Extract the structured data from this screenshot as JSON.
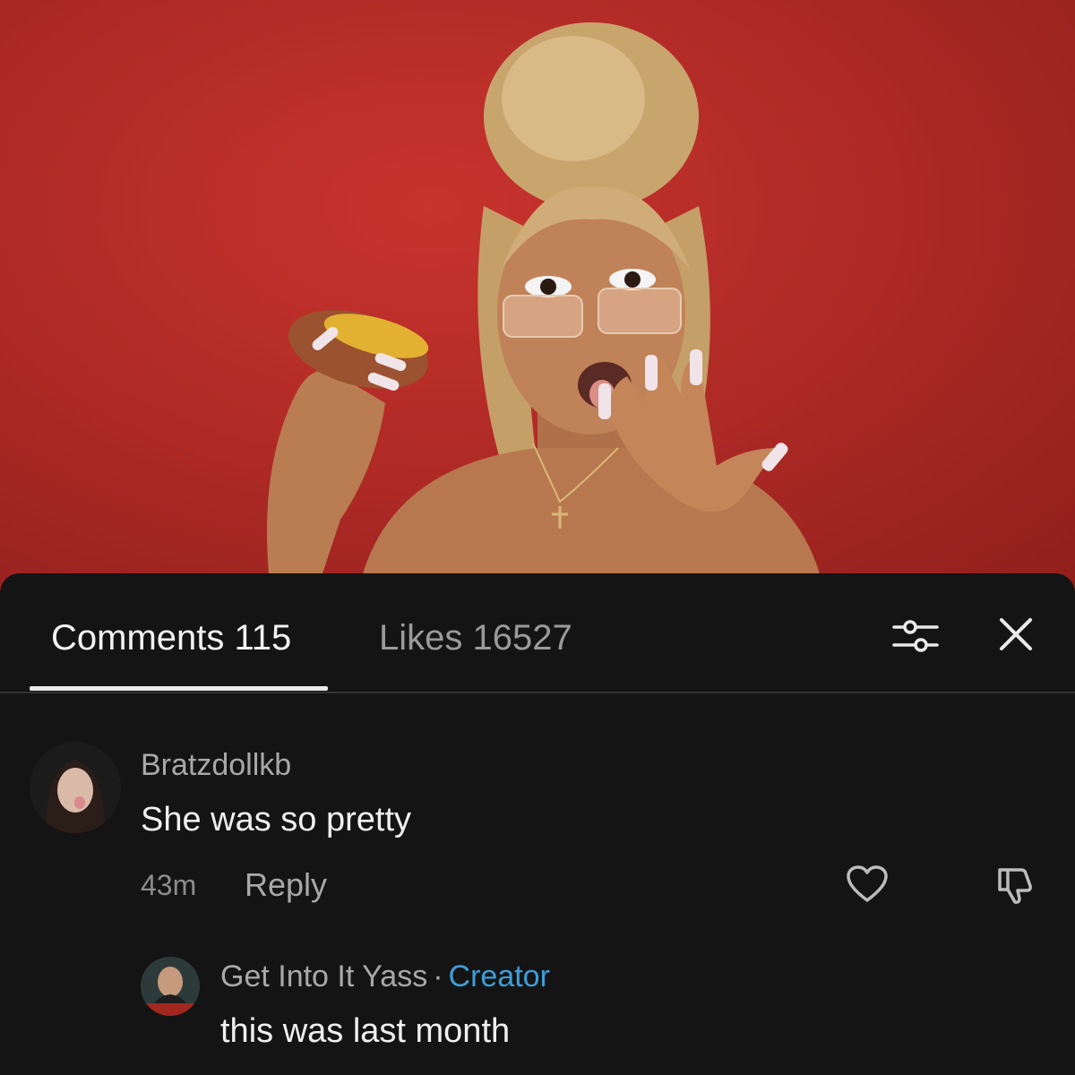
{
  "tabs": {
    "comments_label": "Comments 115",
    "likes_label": "Likes 16527"
  },
  "toolbar": {
    "filter_icon": "sliders-icon",
    "close_icon": "close-icon"
  },
  "comments": [
    {
      "username": "Bratzdollkb",
      "text": "She was so pretty",
      "time": "43m",
      "reply_label": "Reply",
      "like_icon": "heart-icon",
      "dislike_icon": "thumbs-down-icon"
    }
  ],
  "replies": [
    {
      "username": "Get Into It Yass",
      "separator": "·",
      "badge": "Creator",
      "text": "this was last month"
    }
  ],
  "colors": {
    "background": "#141414",
    "hero_red": "#b12b26",
    "creator_blue": "#3e9ed8",
    "muted_text": "#a8a8a8"
  }
}
